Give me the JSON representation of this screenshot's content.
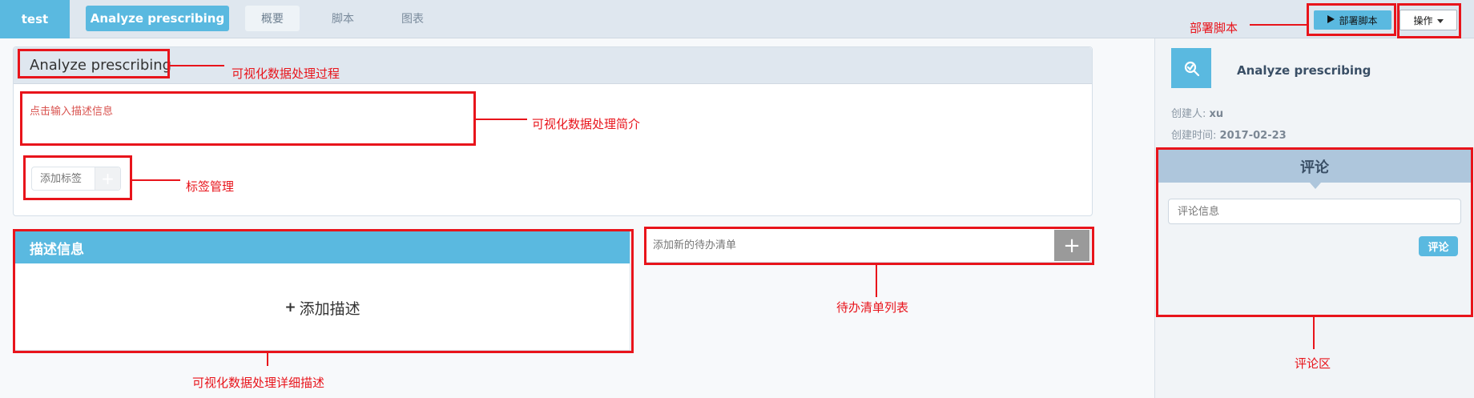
{
  "topbar": {
    "logo": "test",
    "title": "Analyze prescribing",
    "tabs": [
      {
        "label": "概要",
        "active": true
      },
      {
        "label": "脚本",
        "active": false
      },
      {
        "label": "图表",
        "active": false
      }
    ],
    "deploy_label": "部署脚本",
    "ops_label": "操作"
  },
  "main": {
    "card_title": "Analyze prescribing",
    "description_placeholder": "点击输入描述信息",
    "tag_placeholder": "添加标签",
    "tag_add_glyph": "+",
    "desc_panel_title": "描述信息",
    "add_desc_plus": "+",
    "add_desc_label": "添加描述",
    "todo_placeholder": "添加新的待办清单",
    "todo_add_glyph": "+"
  },
  "sidebar": {
    "title": "Analyze prescribing",
    "creator_label": "创建人:",
    "creator": "xu",
    "created_label": "创建时间:",
    "created": "2017-02-23",
    "comment_title": "评论",
    "comment_placeholder": "评论信息",
    "comment_button": "评论"
  },
  "annotations": {
    "deploy": "部署脚本",
    "card_title": "可视化数据处理过程",
    "description": "可视化数据处理简介",
    "tags": "标签管理",
    "todo": "待办清单列表",
    "detail": "可视化数据处理详细描述",
    "comment": "评论区"
  },
  "colors": {
    "accent": "#5ab9e0",
    "annotation": "#e8141b",
    "comment_header": "#aec6dc"
  }
}
